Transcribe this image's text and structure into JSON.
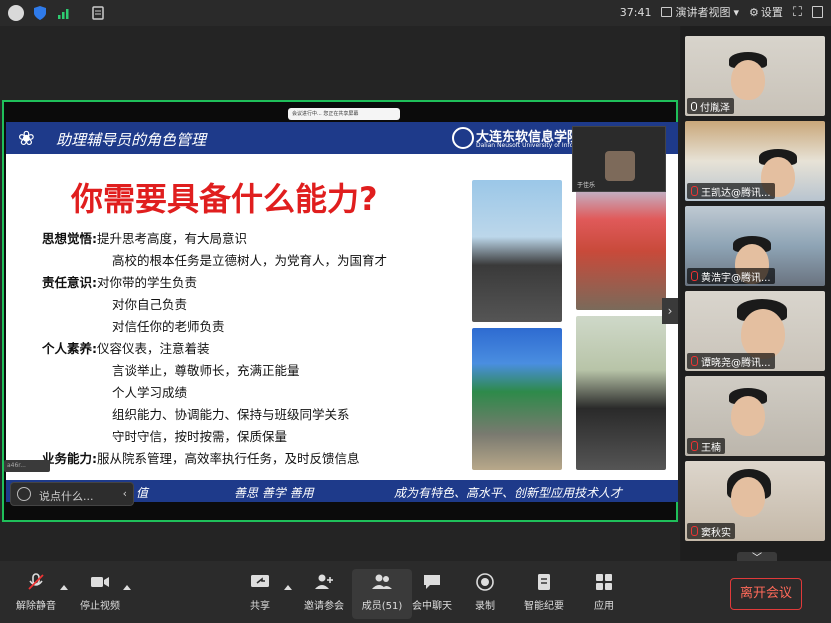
{
  "topbar": {
    "timer": "37:41",
    "presenter_view": "演讲者视图",
    "settings": "设置"
  },
  "share": {
    "bar_text": "会议进行中... 您正在共享屏幕",
    "speaker_name": "于佳乐",
    "name_pill": "a46r...",
    "chat_placeholder": "说点什么..."
  },
  "slide": {
    "title": "助理辅导员的角色管理",
    "university_name": "大连东软信息学院",
    "university_sub": "Dalian Neusoft University of Information",
    "question": "你需要具备什么能力?",
    "rows": [
      {
        "label": "思想觉悟:",
        "text": "提升思考高度，有大局意识"
      },
      {
        "label": "",
        "text": "高校的根本任务是立德树人，为党育人，为国育才"
      },
      {
        "label": "责任意识:",
        "text": "对你带的学生负责"
      },
      {
        "label": "",
        "text": "对你自己负责"
      },
      {
        "label": "",
        "text": "对信任你的老师负责"
      },
      {
        "label": "个人素养:",
        "text": "仪容仪表，注意着装"
      },
      {
        "label": "",
        "text": "言谈举止，尊敬师长，充满正能量"
      },
      {
        "label": "",
        "text": "个人学习成绩"
      },
      {
        "label": "",
        "text": "组织能力、协调能力、保持与班级同学关系"
      },
      {
        "label": "",
        "text": "守时守信，按时按需，保质保量"
      },
      {
        "label": "业务能力:",
        "text": "服从院系管理，高效率执行任务，及时反馈信息"
      }
    ],
    "footer_left": "值",
    "footer_mid": "善思  善学  善用",
    "footer_right": "成为有特色、高水平、创新型应用技术人才"
  },
  "participants": [
    {
      "name": "付胤泽",
      "muted": false
    },
    {
      "name": "王凯达@腾讯...",
      "muted": true
    },
    {
      "name": "黄浩宇@腾讯...",
      "muted": true
    },
    {
      "name": "谭晓尧@腾讯...",
      "muted": true
    },
    {
      "name": "王楠",
      "muted": true
    },
    {
      "name": "窦秋实",
      "muted": true
    }
  ],
  "toolbar": {
    "unmute": "解除静音",
    "stop_video": "停止视频",
    "share": "共享",
    "invite": "邀请参会",
    "members": "成员(51)",
    "chat": "会中聊天",
    "record": "录制",
    "minutes": "智能纪要",
    "apps": "应用",
    "leave": "离开会议"
  },
  "colors": {
    "accent_green": "#1fbf5a",
    "slide_blue": "#1e3a8a",
    "question_red": "#e01e1e",
    "leave_red": "#e03a3a"
  }
}
